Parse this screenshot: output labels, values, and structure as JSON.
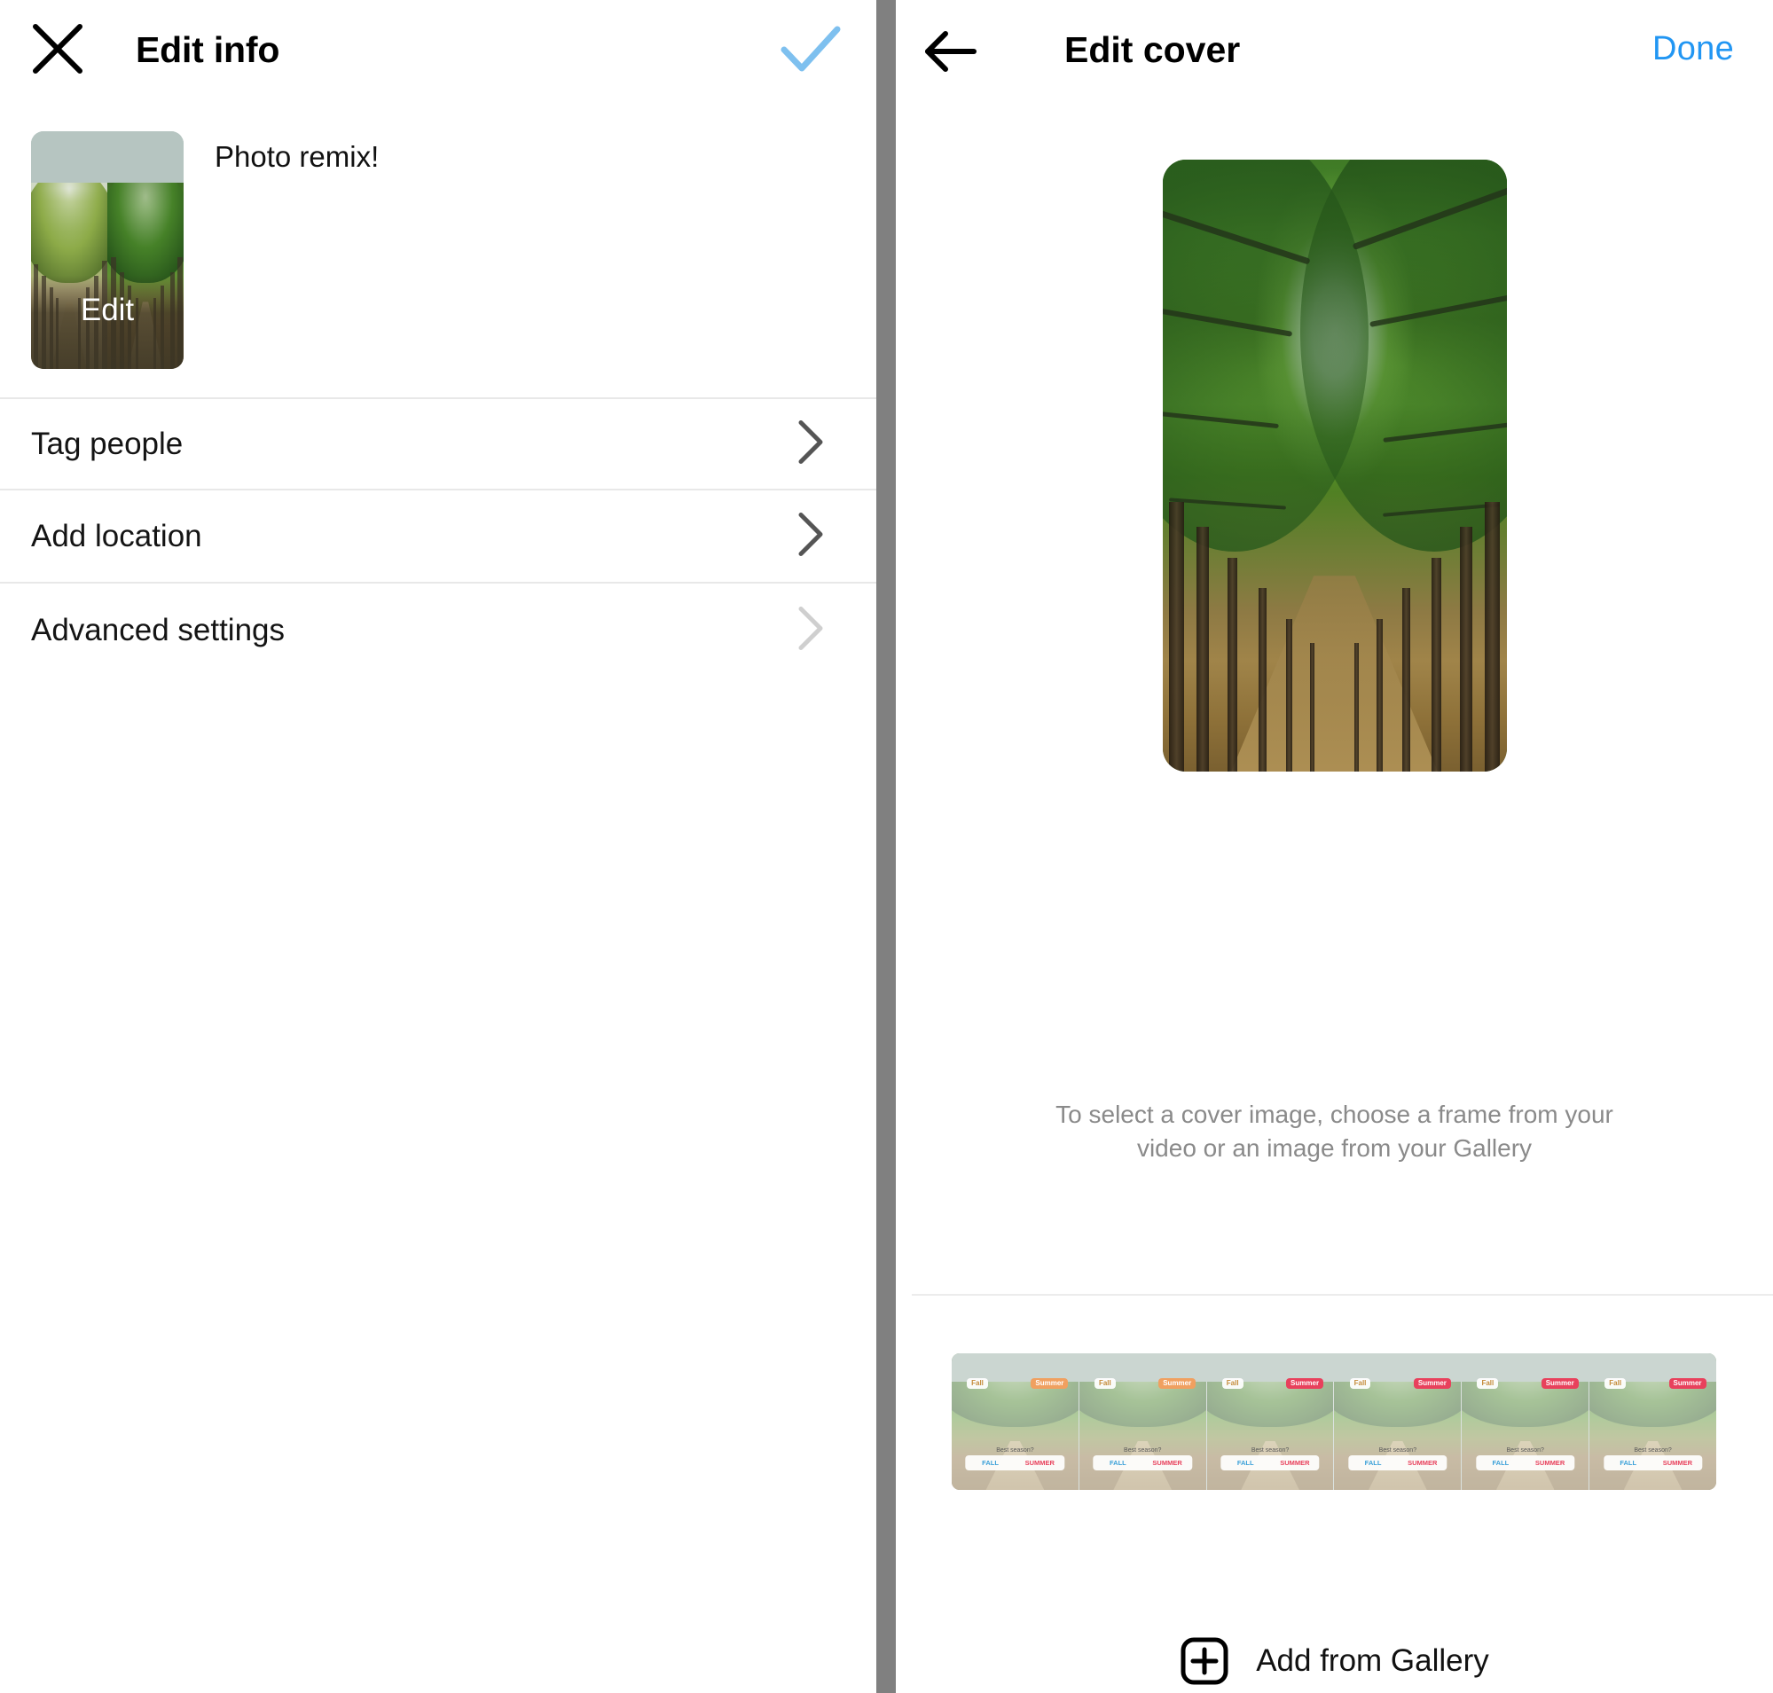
{
  "left_panel": {
    "header": {
      "close_icon": "close-x-icon",
      "title": "Edit info",
      "confirm_icon": "checkmark-icon"
    },
    "thumbnail": {
      "edit_overlay_label": "Edit",
      "caption": "Photo remix!"
    },
    "rows": [
      {
        "label": "Tag people",
        "chevron": "chevron-right-icon",
        "dimmed": false
      },
      {
        "label": "Add location",
        "chevron": "chevron-right-icon",
        "dimmed": false
      },
      {
        "label": "Advanced settings",
        "chevron": "chevron-right-icon",
        "dimmed": true
      }
    ]
  },
  "right_panel": {
    "header": {
      "back_icon": "arrow-left-icon",
      "title": "Edit cover",
      "done_label": "Done",
      "done_color": "#2196f3"
    },
    "hint_line_1": "To select a cover image, choose a frame from your",
    "hint_line_2": "video or an image from your Gallery",
    "filmstrip": {
      "frames": [
        {
          "tag_fall": "Fall",
          "tag_summer": "Summer",
          "summer_style": "warm",
          "poll_question": "Best season?",
          "option_1": "FALL",
          "option_2": "SUMMER"
        },
        {
          "tag_fall": "Fall",
          "tag_summer": "Summer",
          "summer_style": "warm",
          "poll_question": "Best season?",
          "option_1": "FALL",
          "option_2": "SUMMER"
        },
        {
          "tag_fall": "Fall",
          "tag_summer": "Summer",
          "summer_style": "hot",
          "poll_question": "Best season?",
          "option_1": "FALL",
          "option_2": "SUMMER"
        },
        {
          "tag_fall": "Fall",
          "tag_summer": "Summer",
          "summer_style": "hot",
          "poll_question": "Best season?",
          "option_1": "FALL",
          "option_2": "SUMMER"
        },
        {
          "tag_fall": "Fall",
          "tag_summer": "Summer",
          "summer_style": "hot",
          "poll_question": "Best season?",
          "option_1": "FALL",
          "option_2": "SUMMER"
        },
        {
          "tag_fall": "Fall",
          "tag_summer": "Summer",
          "summer_style": "hot",
          "poll_question": "Best season?",
          "option_1": "FALL",
          "option_2": "SUMMER"
        }
      ]
    },
    "gallery_button": {
      "icon": "plus-square-icon",
      "label": "Add from Gallery"
    }
  },
  "colors": {
    "accent": "#2196f3",
    "check": "#7ec0ef",
    "divider": "#808080",
    "row_border": "#e8e8e8",
    "hint_text": "#8a8a8a"
  }
}
